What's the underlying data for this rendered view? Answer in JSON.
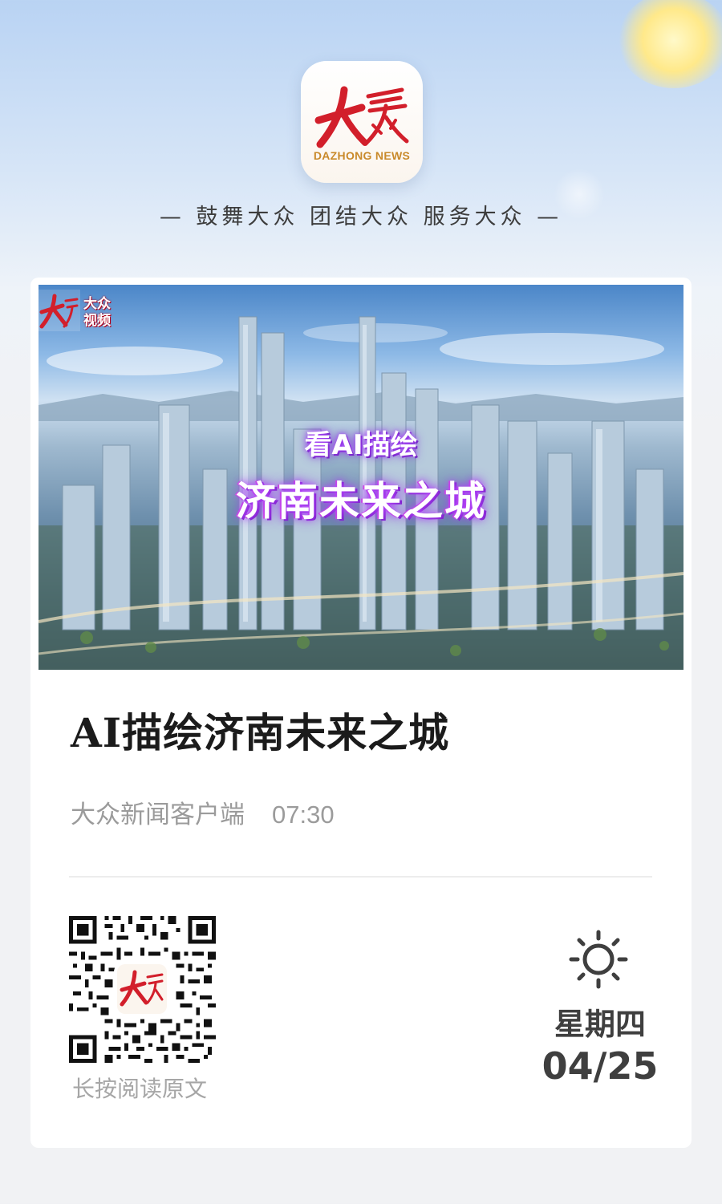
{
  "header": {
    "brand_en": "DAZHONG NEWS",
    "slogan": "— 鼓舞大众 团结大众 服务大众 —",
    "logo_icon": "dazhong-logo-icon",
    "sun_decoration": "sun-icon"
  },
  "article": {
    "cover": {
      "corner_label": "大众\n视频",
      "overlay_line1": "看AI描绘",
      "overlay_line2": "济南未来之城"
    },
    "title": "AI描绘济南未来之城",
    "source": "大众新闻客户端",
    "time": "07:30"
  },
  "footer": {
    "qr_caption": "长按阅读原文",
    "weather_icon": "sunny-icon",
    "weekday": "星期四",
    "date": "04/25"
  },
  "colors": {
    "brand_red": "#d21f2b",
    "brand_gold": "#c98a2a",
    "title_text": "#1b1b1b",
    "meta_text": "#9b9b9b"
  }
}
